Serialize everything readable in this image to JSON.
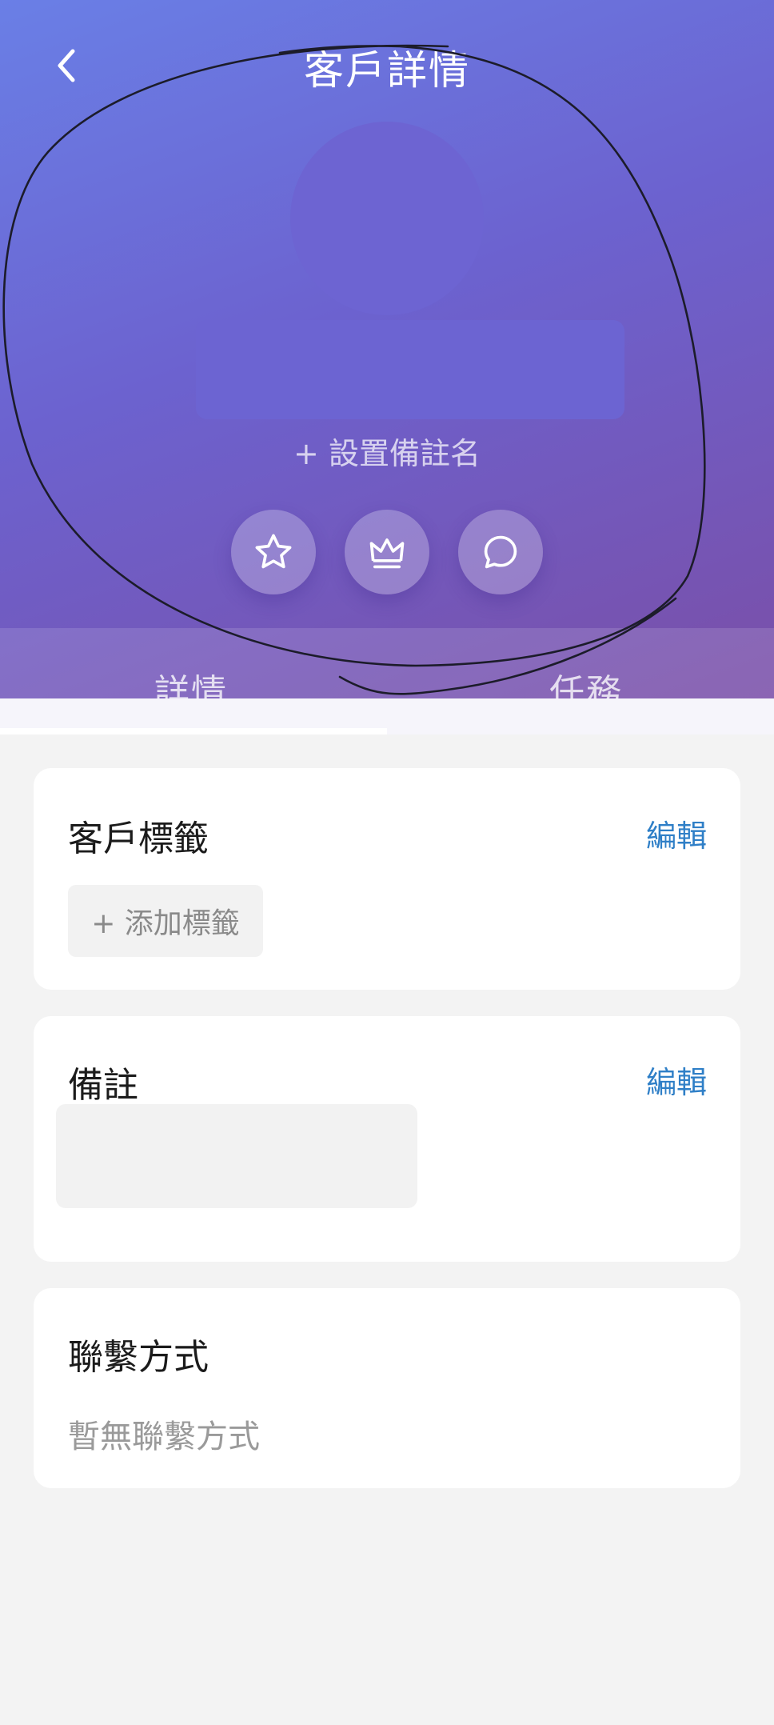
{
  "header": {
    "title": "客戶詳情",
    "set_remark_name": "+ 設置備註名",
    "actions": [
      {
        "name": "star-icon"
      },
      {
        "name": "crown-icon"
      },
      {
        "name": "chat-bubble-icon"
      }
    ]
  },
  "tabs": [
    {
      "label": "詳情",
      "active": true
    },
    {
      "label": "任務",
      "active": false
    }
  ],
  "tags_card": {
    "title": "客戶標籤",
    "edit_label": "編輯",
    "add_tag_label": "+ 添加標籤"
  },
  "remark_card": {
    "title": "備註",
    "edit_label": "編輯"
  },
  "contact_card": {
    "title": "聯繫方式",
    "empty_text": "暫無聯繫方式"
  },
  "colors": {
    "gradient_start": "#6a7fe6",
    "gradient_end": "#7a4fa8",
    "link": "#2f7fc7",
    "page_bg": "#f3f3f3"
  }
}
